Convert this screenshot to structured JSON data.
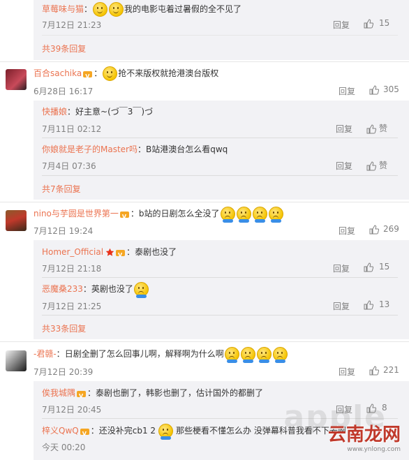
{
  "reply_label": "回复",
  "like_label": "赞",
  "colors": {
    "accent": "#eb7350",
    "text": "#333333",
    "meta": "#808080",
    "reply_bg": "#f2f2f5"
  },
  "top_reply": {
    "name": "草莓味与猫",
    "sep": "：",
    "text": "我的电影屯着过暑假的全不见了",
    "time": "7月12日 21:23",
    "likes": "15"
  },
  "top_more": "共39条回复",
  "c1": {
    "name": "百合sachika",
    "sep": "：",
    "text": "抢不来版权就抢港澳台版权",
    "time": "6月28日 16:17",
    "likes": "305",
    "replies": [
      {
        "name": "快播娘",
        "sep": "：",
        "text": "好主意~(づ￣3￣)づ",
        "time": "7月11日 02:12"
      },
      {
        "name": "你娘就是老子的Master吗",
        "sep": "：",
        "text": "B站港澳台怎么看qwq",
        "time": "7月4日 07:36"
      }
    ],
    "more": "共7条回复"
  },
  "c2": {
    "name": "nino与芋圆是世界第一",
    "sep": "：",
    "text": "b站的日剧怎么全没了",
    "time": "7月12日 19:24",
    "likes": "269",
    "replies": [
      {
        "name": "Homer_Official",
        "sep": "：",
        "text": "泰剧也没了",
        "time": "7月12日 21:18",
        "likes": "15"
      },
      {
        "name": "恶魔桑233",
        "sep": "：",
        "text": "英剧也没了",
        "time": "7月12日 21:25",
        "likes": "13"
      }
    ],
    "more": "共33条回复"
  },
  "c3": {
    "name": "-君赣-",
    "sep": "：",
    "text": "日剧全删了怎么回事儿啊，解释啊为什么啊",
    "time": "7月12日 20:39",
    "likes": "221",
    "replies": [
      {
        "name": "俟我城隅",
        "sep": "：",
        "text": "泰剧也删了，韩影也删了，估计国外的都删了",
        "time": "7月12日 20:45",
        "likes": "8"
      },
      {
        "name": "梓义QwQ",
        "sep": "：",
        "text": "还没补完cb1 2",
        "text2": "那些梗看不懂怎么办 没弹幕科普我看不下去啊",
        "time": "今天 00:20"
      }
    ]
  },
  "watermark": "云南龙网",
  "watermark_url": "www.ynlong.com",
  "site_mark": "apple"
}
